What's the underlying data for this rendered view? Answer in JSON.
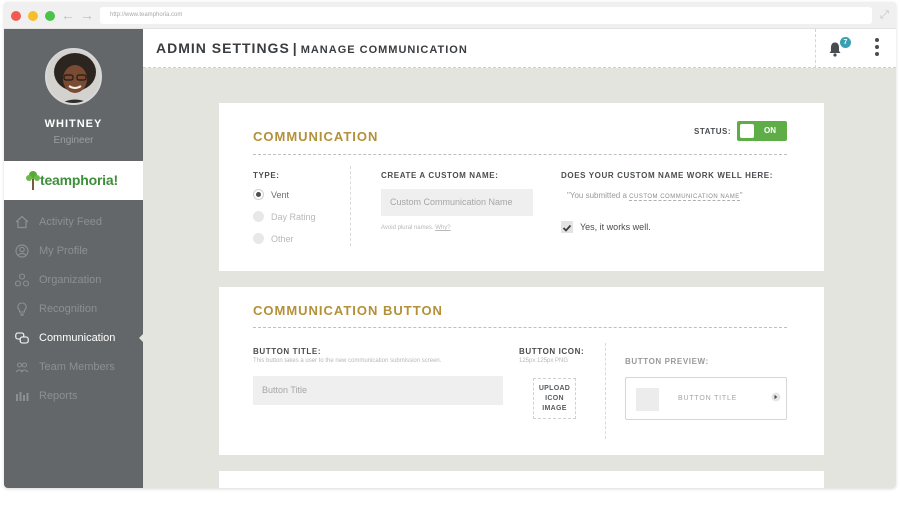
{
  "browser": {
    "url": "http://www.teamphoria.com"
  },
  "user": {
    "name": "WHITNEY",
    "role": "Engineer"
  },
  "logo": {
    "text": "teamphoria!"
  },
  "sidebar": {
    "items": [
      {
        "label": "Activity Feed",
        "icon": "home-icon"
      },
      {
        "label": "My Profile",
        "icon": "user-icon"
      },
      {
        "label": "Organization",
        "icon": "organization-icon"
      },
      {
        "label": "Recognition",
        "icon": "lightbulb-icon"
      },
      {
        "label": "Communication",
        "icon": "chat-bubbles-icon",
        "active": true
      },
      {
        "label": "Team Members",
        "icon": "team-icon"
      },
      {
        "label": "Reports",
        "icon": "bar-chart-icon"
      }
    ]
  },
  "header": {
    "title": "ADMIN SETTINGS",
    "separator": "|",
    "subtitle": "MANAGE COMMUNICATION",
    "notification_count": "7"
  },
  "communication": {
    "title": "COMMUNICATION",
    "status_label": "STATUS:",
    "status_value": "ON",
    "type_label": "TYPE:",
    "types": [
      {
        "label": "Vent",
        "selected": true
      },
      {
        "label": "Day Rating",
        "selected": false
      },
      {
        "label": "Other",
        "selected": false
      }
    ],
    "custom_name_label": "CREATE A CUSTOM NAME:",
    "custom_name_placeholder": "Custom Communication Name",
    "helper_text": "Avoid plural names.",
    "helper_link": "Why?",
    "works_label": "DOES YOUR CUSTOM NAME WORK WELL HERE:",
    "submitted_prefix": "\"You submitted a",
    "submitted_name": "CUSTOM COMMUNICATION NAME",
    "submitted_suffix": "\"",
    "works_confirm": "Yes, it works well."
  },
  "communication_button": {
    "title": "COMMUNICATION BUTTON",
    "button_title_label": "BUTTON TITLE:",
    "button_title_helper": "This button takes a user to the new communication submission screen.",
    "button_title_placeholder": "Button Title",
    "button_icon_label": "BUTTON ICON:",
    "button_icon_helper": "125px 125px PNG",
    "upload_line1": "UPLOAD",
    "upload_line2": "ICON",
    "upload_line3": "IMAGE",
    "preview_label": "BUTTON PREVIEW:",
    "preview_text": "BUTTON TITLE"
  },
  "colors": {
    "accent_gold": "#b3913a",
    "toggle_green": "#5fad46",
    "sidebar_bg": "#636769",
    "badge_teal": "#3a9fb1"
  }
}
